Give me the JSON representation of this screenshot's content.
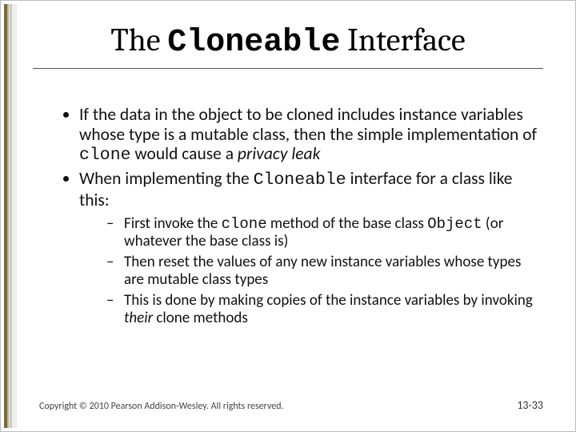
{
  "title": {
    "pre": "The ",
    "code": "Cloneable",
    "post": " Interface"
  },
  "bullets": [
    {
      "segments": [
        {
          "t": "If the data in the object to be cloned includes instance variables whose type is a mutable class, then the simple implementation of "
        },
        {
          "t": "clone",
          "mono": true
        },
        {
          "t": " would cause a "
        },
        {
          "t": "privacy leak",
          "ital": true
        }
      ]
    },
    {
      "segments": [
        {
          "t": "When implementing the "
        },
        {
          "t": "Cloneable",
          "mono": true
        },
        {
          "t": " interface for a class like this:"
        }
      ],
      "sub": [
        {
          "segments": [
            {
              "t": "First invoke the "
            },
            {
              "t": "clone",
              "mono": true
            },
            {
              "t": " method of the base class "
            },
            {
              "t": "Object",
              "mono": true
            },
            {
              "t": " (or whatever the base class is)"
            }
          ]
        },
        {
          "segments": [
            {
              "t": "Then reset the values of any new instance variables whose types are mutable class types"
            }
          ]
        },
        {
          "segments": [
            {
              "t": " This is done by making copies of the instance variables by invoking "
            },
            {
              "t": "their",
              "ital": true
            },
            {
              "t": " clone methods"
            }
          ]
        }
      ]
    }
  ],
  "footer": {
    "copyright": "Copyright © 2010 Pearson Addison-Wesley. All rights reserved.",
    "page": "13-33"
  }
}
